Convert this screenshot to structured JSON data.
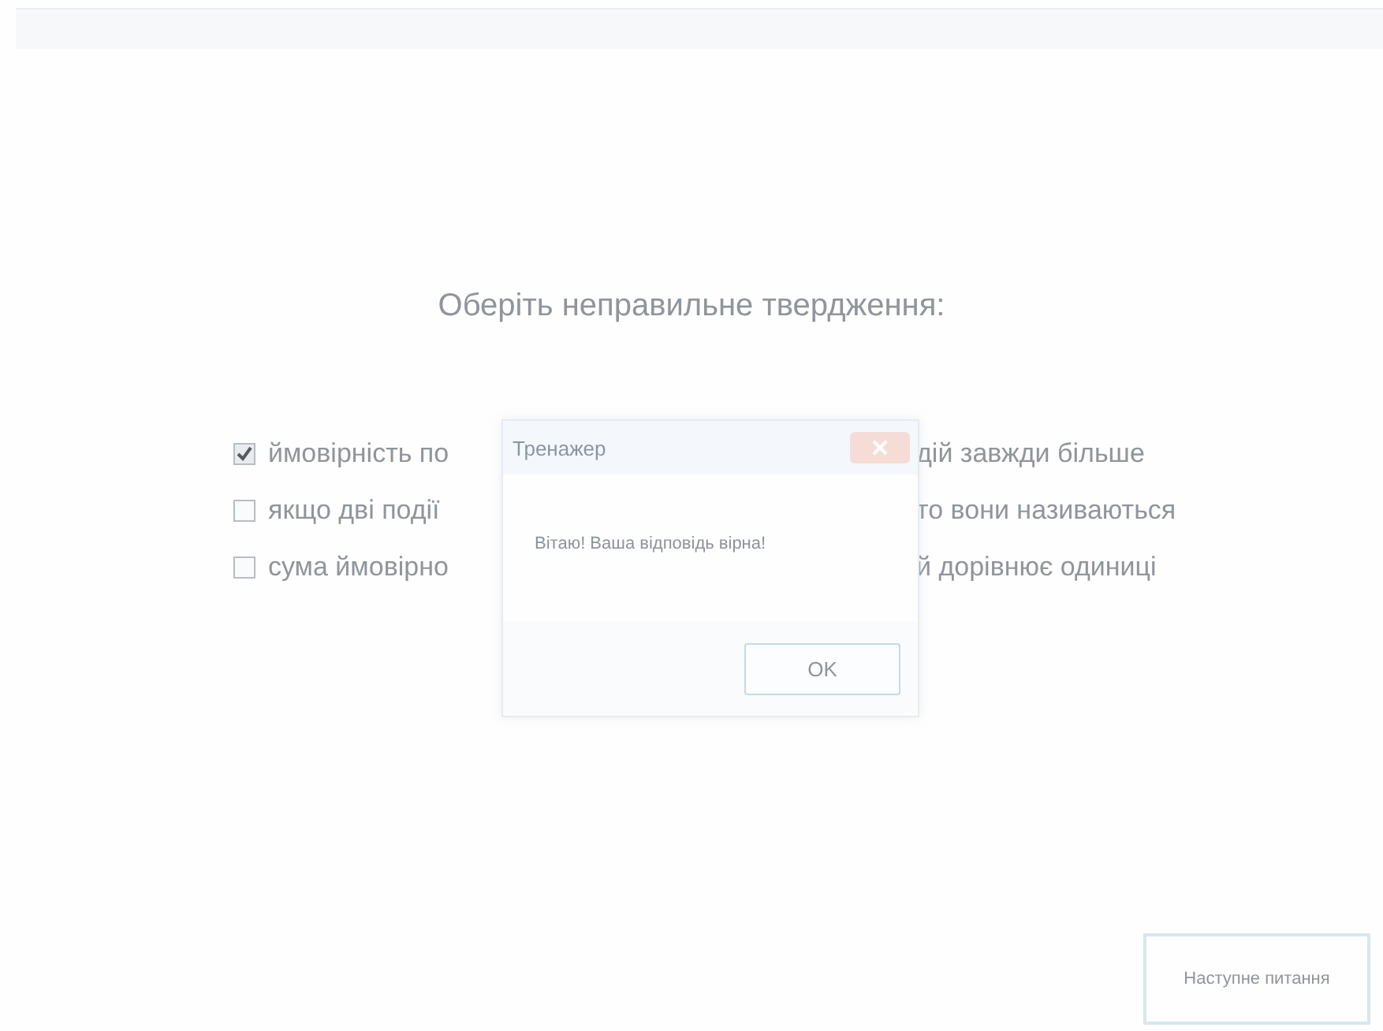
{
  "question": "Оберіть неправильне твердження:",
  "options": [
    {
      "visible_start": "ймовірність по",
      "visible_end": "дій завжди більше",
      "checked": true
    },
    {
      "visible_start": "якщо дві події",
      "visible_end": "то вони називаються",
      "checked": false
    },
    {
      "visible_start": "сума ймовірно",
      "visible_end": "й дорівнює одиниці",
      "checked": false
    }
  ],
  "dialog": {
    "title": "Тренажер",
    "message": "Вітаю! Ваша відповідь вірна!",
    "button": "OK"
  },
  "next_button": "Наступне питання"
}
